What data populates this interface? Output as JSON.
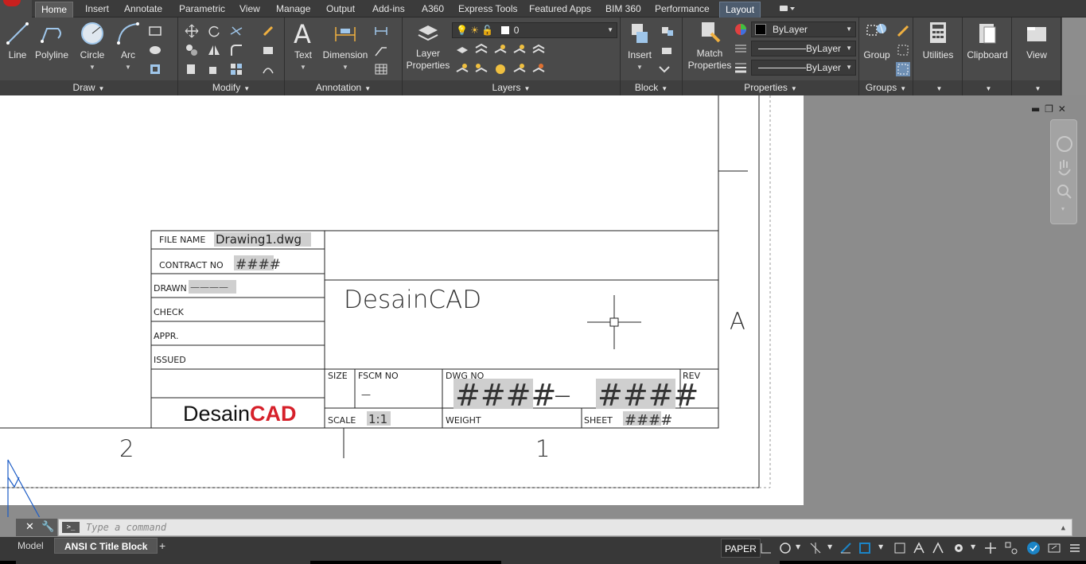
{
  "ribbon_tabs": [
    "Home",
    "Insert",
    "Annotate",
    "Parametric",
    "View",
    "Manage",
    "Output",
    "Add-ins",
    "A360",
    "Express Tools",
    "Featured Apps",
    "BIM 360",
    "Performance",
    "Layout"
  ],
  "active_tab": "Home",
  "draw": {
    "title": "Draw",
    "line": "Line",
    "polyline": "Polyline",
    "circle": "Circle",
    "arc": "Arc"
  },
  "modify": {
    "title": "Modify"
  },
  "annotation": {
    "title": "Annotation",
    "text": "Text",
    "dimension": "Dimension"
  },
  "layers": {
    "title": "Layers",
    "layer_props_1": "Layer",
    "layer_props_2": "Properties",
    "current_layer": "0"
  },
  "block": {
    "title": "Block",
    "insert": "Insert"
  },
  "properties": {
    "title": "Properties",
    "match_1": "Match",
    "match_2": "Properties",
    "color": "ByLayer",
    "linetype": "ByLayer",
    "lineweight": "ByLayer"
  },
  "groups": {
    "title": "Groups",
    "group": "Group"
  },
  "utilities": "Utilities",
  "clipboard": "Clipboard",
  "view": "View",
  "titleblock": {
    "file_name_label": "FILE NAME",
    "file_name": "Drawing1.dwg",
    "contract_label": "CONTRACT NO",
    "contract_no": "####",
    "drawn_label": "DRAWN",
    "drawn_value": "————",
    "check_label": "CHECK",
    "appr_label": "APPR.",
    "issued_label": "ISSUED",
    "company": "DesainCAD",
    "logo_black": "Desain",
    "logo_red": "CAD",
    "size_label": "SIZE",
    "fscm_label": "FSCM NO",
    "fscm_value": "—",
    "dwg_label": "DWG NO",
    "dwg_part1": "####",
    "dwg_sep": "—",
    "dwg_part2": "####",
    "rev_label": "REV",
    "scale_label": "SCALE",
    "scale_value": "1:1",
    "weight_label": "WEIGHT",
    "sheet_label": "SHEET",
    "sheet_value": "####",
    "zone_2": "2",
    "zone_1": "1",
    "zone_a": "A"
  },
  "command": {
    "placeholder": "Type a command"
  },
  "layout_tabs": {
    "model": "Model",
    "active": "ANSI C Title Block",
    "add": "+"
  },
  "status": {
    "paper": "PAPER"
  },
  "colors": {
    "accent": "#1c84c6",
    "logo_red": "#d6202a",
    "ribbon": "#4a4a4a",
    "highlight": "#cfcfcf"
  }
}
